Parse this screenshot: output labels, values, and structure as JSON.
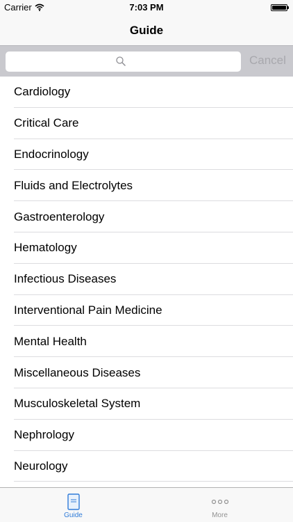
{
  "status_bar": {
    "carrier": "Carrier",
    "time": "7:03 PM"
  },
  "nav": {
    "title": "Guide"
  },
  "search": {
    "placeholder": "",
    "cancel_label": "Cancel"
  },
  "list": {
    "items": [
      "Cardiology",
      "Critical Care",
      "Endocrinology",
      "Fluids and Electrolytes",
      "Gastroenterology",
      "Hematology",
      "Infectious Diseases",
      "Interventional Pain Medicine",
      "Mental Health",
      "Miscellaneous Diseases",
      "Musculoskeletal System",
      "Nephrology",
      "Neurology"
    ]
  },
  "tab_bar": {
    "tabs": [
      {
        "label": "Guide",
        "icon": "book-icon",
        "selected": true
      },
      {
        "label": "More",
        "icon": "more-dots-icon",
        "selected": false
      }
    ]
  },
  "colors": {
    "accent": "#2f7bd8",
    "search_bar_bg": "#c9c9ce",
    "cancel_text": "#a8a8ad"
  }
}
